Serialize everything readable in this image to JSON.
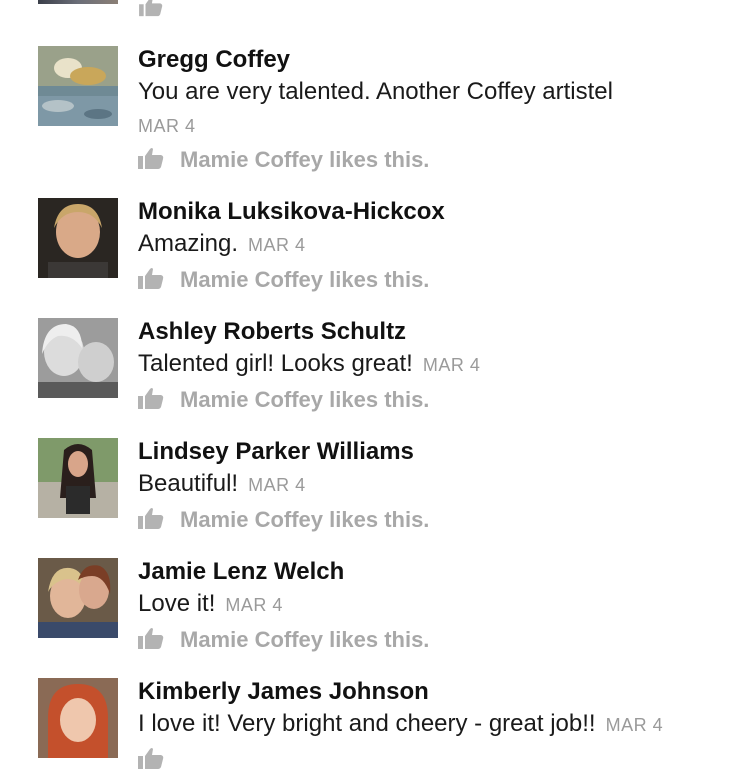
{
  "comments": [
    {
      "name": "Gregg Coffey",
      "text": "You are very talented. Another Coffey artistel",
      "date": "MAR 4",
      "likes": "Mamie Coffey likes this.",
      "avatar": "avatar-gregg"
    },
    {
      "name": "Monika Luksikova-Hickcox",
      "text": "Amazing.",
      "date": "MAR 4",
      "likes": "Mamie Coffey likes this.",
      "avatar": "avatar-monika"
    },
    {
      "name": "Ashley Roberts Schultz",
      "text": "Talented girl! Looks great!",
      "date": "MAR 4",
      "likes": "Mamie Coffey likes this.",
      "avatar": "avatar-ashley"
    },
    {
      "name": "Lindsey Parker Williams",
      "text": "Beautiful!",
      "date": "MAR 4",
      "likes": "Mamie Coffey likes this.",
      "avatar": "avatar-lindsey"
    },
    {
      "name": "Jamie Lenz Welch",
      "text": "Love it!",
      "date": "MAR 4",
      "likes": "Mamie Coffey likes this.",
      "avatar": "avatar-jamie"
    },
    {
      "name": "Kimberly James Johnson",
      "text": "I love it! Very bright and cheery - great job!!",
      "date": "MAR 4",
      "avatar": "avatar-kimberly"
    }
  ],
  "icons": {
    "like": "thumbs-up-icon"
  },
  "colors": {
    "name": "#111111",
    "text": "#1a1a1a",
    "meta": "#9a9a9a",
    "likes": "#a8a8a8"
  }
}
